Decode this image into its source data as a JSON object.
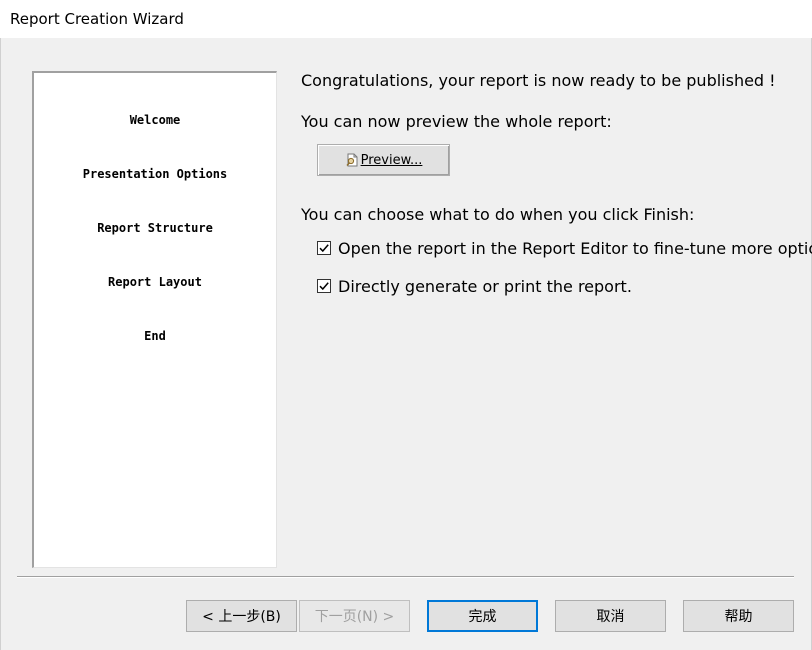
{
  "window": {
    "title": "Report Creation Wizard"
  },
  "steps": [
    "Welcome",
    "Presentation Options",
    "Report Structure",
    "Report Layout",
    "End"
  ],
  "main": {
    "headline": "Congratulations, your report is now ready to be published !",
    "preview_prompt": "You can now preview the whole report:",
    "preview_button": "Preview...",
    "finish_prompt": "You can choose what to do when you click Finish:",
    "options": [
      {
        "label": "Open the report in the Report Editor to fine-tune more optio",
        "checked": true
      },
      {
        "label": "Directly generate or print the report.",
        "checked": true
      }
    ]
  },
  "buttons": {
    "back": "< 上一步(B)",
    "next": "下一页(N) >",
    "finish": "完成",
    "cancel": "取消",
    "help": "帮助"
  },
  "colors": {
    "default_button_border": "#0078d7",
    "disabled_text": "#a0a0a0"
  }
}
